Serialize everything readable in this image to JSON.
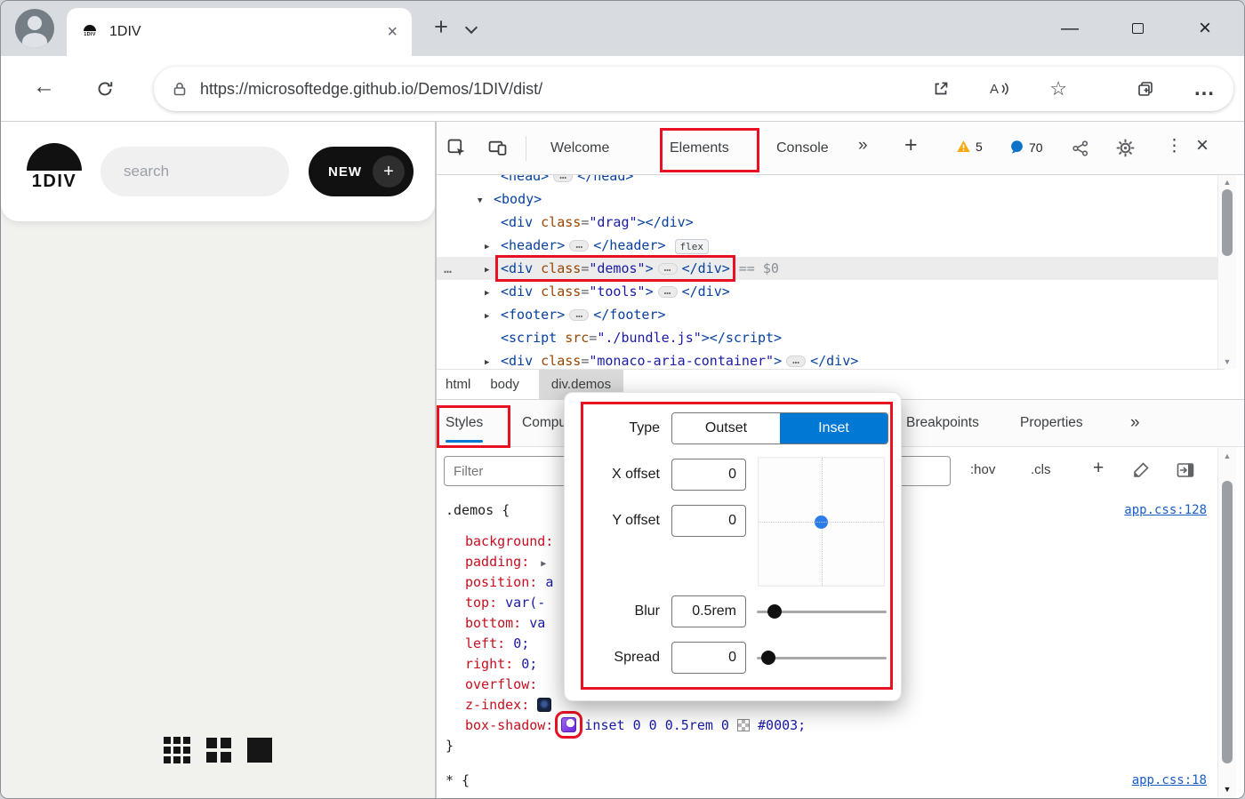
{
  "colors": {
    "accent-blue": "#0078d4",
    "annotation-red": "#e81123",
    "tag-blue": "#0842a0",
    "attr-orange": "#994500",
    "value-blue": "#1a1aa6",
    "property-red": "#c50f1f",
    "warning-orange": "#f8a912",
    "message-blue": "#0b72c9",
    "app-black": "#111111"
  },
  "window": {
    "tab": {
      "favicon_text": "1DIV",
      "title": "1DIV",
      "close_glyph": "×"
    },
    "new_tab_glyph": "+",
    "controls": {
      "minimize": "—",
      "close": "×"
    },
    "url": "https://microsoftedge.github.io/Demos/1DIV/dist/",
    "back_glyph": "←",
    "star_glyph": "☆",
    "more_glyph": "…"
  },
  "app": {
    "logo_text": "1DIV",
    "search_placeholder": "search",
    "new_button": {
      "label": "NEW",
      "plus": "+"
    }
  },
  "devtools": {
    "tabs": [
      {
        "label": "Welcome"
      },
      {
        "label": "Elements"
      },
      {
        "label": "Console"
      }
    ],
    "overflow_glyph": "»",
    "add_glyph": "+",
    "warning_count": "5",
    "issue_count": "70",
    "more_glyph": "⋮",
    "close_glyph": "×",
    "scroll": {
      "up": "▲",
      "down": "▼"
    },
    "dom_tree": {
      "ellipsis_glyph": "…",
      "rows": [
        {
          "indent": 1,
          "tokens": [
            {
              "c": "tag",
              "t": "<head>"
            },
            {
              "c": "ell"
            },
            {
              "c": "tag",
              "t": "</head>"
            }
          ]
        },
        {
          "indent": 0,
          "arrow": "▼",
          "tokens": [
            {
              "c": "tag",
              "t": "<body>"
            }
          ]
        },
        {
          "indent": 1,
          "tokens": [
            {
              "c": "tag",
              "t": "<div"
            },
            {
              "c": "attr",
              "t": " class"
            },
            {
              "c": "punct",
              "t": "="
            },
            {
              "c": "val",
              "t": "\"drag\""
            },
            {
              "c": "tag",
              "t": "></div>"
            }
          ]
        },
        {
          "indent": 1,
          "arrow": "▶",
          "tokens": [
            {
              "c": "tag",
              "t": "<header>"
            },
            {
              "c": "ell"
            },
            {
              "c": "tag",
              "t": "</header>"
            },
            {
              "c": "badge",
              "t": "flex"
            }
          ]
        },
        {
          "indent": 1,
          "arrow": "▶",
          "gutter": "…",
          "selected": true,
          "annotated": true,
          "meta": "== $0",
          "tokens": [
            {
              "c": "tag",
              "t": "<div"
            },
            {
              "c": "attr",
              "t": " class"
            },
            {
              "c": "punct",
              "t": "="
            },
            {
              "c": "val",
              "t": "\"demos\""
            },
            {
              "c": "tag",
              "t": ">"
            },
            {
              "c": "ell"
            },
            {
              "c": "tag",
              "t": "</div>"
            }
          ]
        },
        {
          "indent": 1,
          "arrow": "▶",
          "tokens": [
            {
              "c": "tag",
              "t": "<div"
            },
            {
              "c": "attr",
              "t": " class"
            },
            {
              "c": "punct",
              "t": "="
            },
            {
              "c": "val",
              "t": "\"tools\""
            },
            {
              "c": "tag",
              "t": ">"
            },
            {
              "c": "ell"
            },
            {
              "c": "tag",
              "t": "</div>"
            }
          ]
        },
        {
          "indent": 1,
          "arrow": "▶",
          "tokens": [
            {
              "c": "tag",
              "t": "<footer>"
            },
            {
              "c": "ell"
            },
            {
              "c": "tag",
              "t": "</footer>"
            }
          ]
        },
        {
          "indent": 1,
          "tokens": [
            {
              "c": "tag",
              "t": "<script"
            },
            {
              "c": "attr",
              "t": " src"
            },
            {
              "c": "punct",
              "t": "="
            },
            {
              "c": "val",
              "t": "\"./bundle.js\""
            },
            {
              "c": "tag",
              "t": "></script>"
            }
          ]
        },
        {
          "indent": 1,
          "arrow": "▶",
          "tokens": [
            {
              "c": "tag",
              "t": "<div"
            },
            {
              "c": "attr",
              "t": " class"
            },
            {
              "c": "punct",
              "t": "="
            },
            {
              "c": "val",
              "t": "\"monaco-aria-container\""
            },
            {
              "c": "tag",
              "t": ">"
            },
            {
              "c": "ell"
            },
            {
              "c": "tag",
              "t": "</div>"
            }
          ]
        }
      ]
    },
    "breadcrumbs": [
      {
        "label": "html"
      },
      {
        "label": "body"
      },
      {
        "label": "div.demos",
        "selected": true
      }
    ],
    "sidebar_tabs": [
      {
        "label": "Styles",
        "active": true
      },
      {
        "label": "Computed"
      },
      {
        "label": "Breakpoints"
      },
      {
        "label": "Properties"
      }
    ],
    "sidebar_overflow_glyph": "»",
    "filter_placeholder": "Filter",
    "toggle_buttons": [
      ":hov",
      ".cls",
      "+"
    ],
    "styles": {
      "rules": [
        {
          "selector": ".demos",
          "link": "app.css:128",
          "declarations": [
            [
              {
                "c": "name",
                "t": "background:"
              }
            ],
            [
              {
                "c": "name",
                "t": "padding:"
              },
              {
                "c": "expand",
                "t": "▶"
              }
            ],
            [
              {
                "c": "name",
                "t": "position:"
              },
              {
                "c": "val",
                "t": "a"
              }
            ],
            [
              {
                "c": "name",
                "t": "top:"
              },
              {
                "c": "val",
                "t": "var(-"
              }
            ],
            [
              {
                "c": "name",
                "t": "bottom:"
              },
              {
                "c": "val",
                "t": "va"
              }
            ],
            [
              {
                "c": "name",
                "t": "left:"
              },
              {
                "c": "val",
                "t": "0;"
              }
            ],
            [
              {
                "c": "name",
                "t": "right:"
              },
              {
                "c": "val",
                "t": "0;"
              }
            ],
            [
              {
                "c": "name",
                "t": "overflow:"
              }
            ],
            [
              {
                "c": "name",
                "t": "z-index:"
              },
              {
                "c": "dark-icon"
              }
            ],
            [
              {
                "c": "name",
                "t": "box-shadow:"
              },
              {
                "c": "shadow-icon",
                "annotated": true
              },
              {
                "c": "val",
                "t": "inset 0 0 0.5rem 0"
              },
              {
                "c": "swatch"
              },
              {
                "c": "val",
                "t": "#0003;"
              }
            ]
          ]
        },
        {
          "selector": "*",
          "link": "app.css:18",
          "declarations": [],
          "close": false
        }
      ]
    },
    "shadow_editor": {
      "type_label": "Type",
      "options": [
        {
          "label": "Outset"
        },
        {
          "label": "Inset",
          "selected": true
        }
      ],
      "fields": [
        {
          "label": "X offset",
          "value": "0"
        },
        {
          "label": "Y offset",
          "value": "0"
        }
      ],
      "sliders": [
        {
          "label": "Blur",
          "value": "0.5rem",
          "position": 0.14
        },
        {
          "label": "Spread",
          "value": "0",
          "position": 0.09
        }
      ]
    }
  }
}
